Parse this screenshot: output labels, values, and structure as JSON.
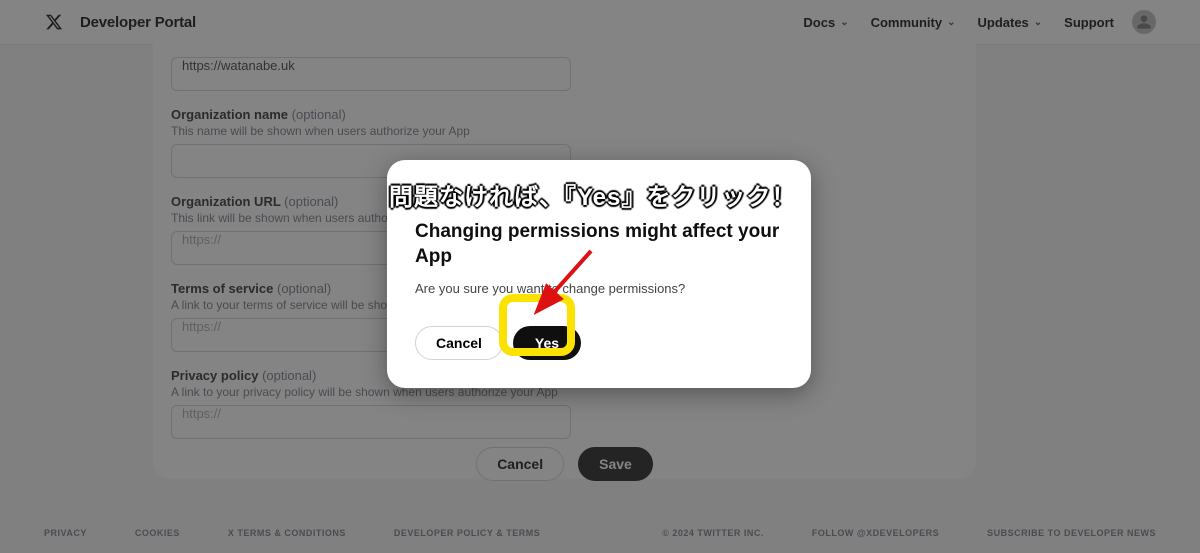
{
  "header": {
    "portal_title": "Developer Portal",
    "nav": {
      "docs": "Docs",
      "community": "Community",
      "updates": "Updates",
      "support": "Support"
    }
  },
  "form": {
    "website_url_value": "https://watanabe.uk",
    "org_name_label": "Organization name",
    "optional": "(optional)",
    "org_name_help": "This name will be shown when users authorize your App",
    "org_url_label": "Organization URL",
    "org_url_help": "This link will be shown when users authorize your App",
    "placeholder_https": "https://",
    "tos_label": "Terms of service",
    "tos_help": "A link to your terms of service will be shown when users authorize your App",
    "privacy_label": "Privacy policy",
    "privacy_help": "A link to your privacy policy will be shown when users authorize your App"
  },
  "page_actions": {
    "cancel": "Cancel",
    "save": "Save"
  },
  "modal": {
    "title": "Changing permissions might affect your App",
    "body": "Are you sure you want to change permissions?",
    "cancel": "Cancel",
    "yes": "Yes"
  },
  "annotation": "問題なければ、『Yes』をクリック！",
  "footer": {
    "privacy": "PRIVACY",
    "cookies": "COOKIES",
    "x_terms": "X TERMS & CONDITIONS",
    "dev_policy": "DEVELOPER POLICY & TERMS",
    "copyright": "© 2024 TWITTER INC.",
    "follow": "FOLLOW @XDEVELOPERS",
    "subscribe": "SUBSCRIBE TO DEVELOPER NEWS"
  }
}
